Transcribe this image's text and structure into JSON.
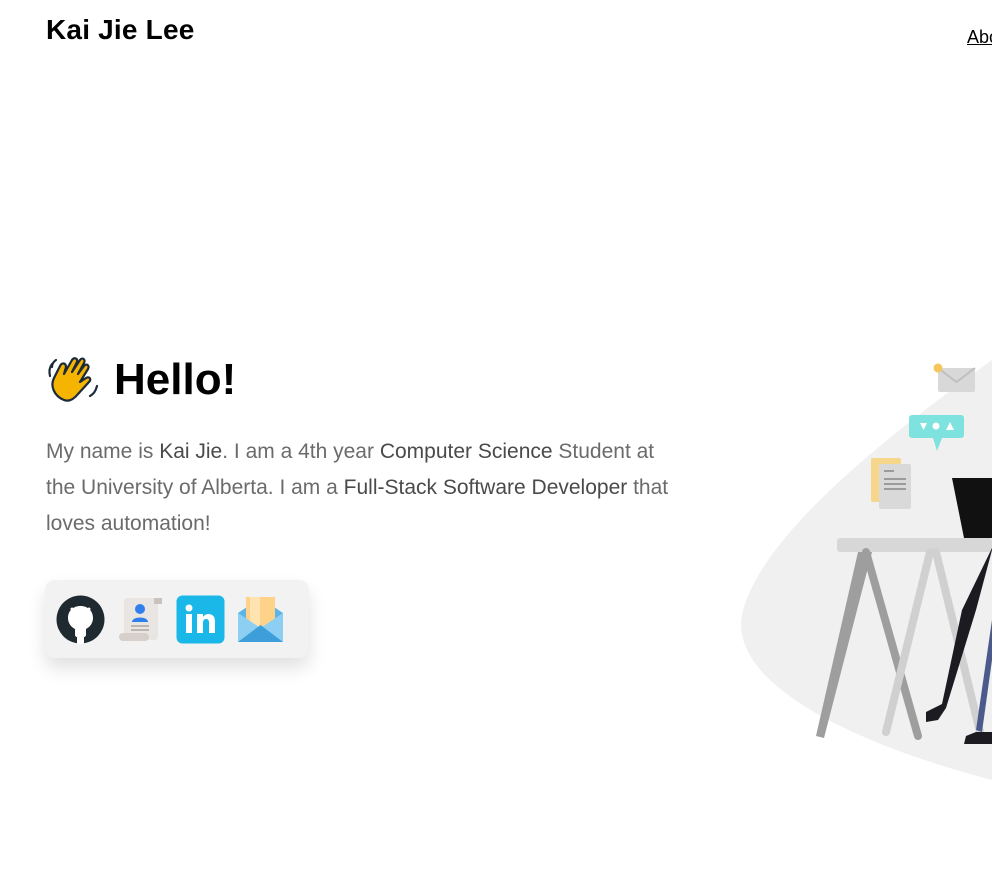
{
  "header": {
    "site_name": "Kai Jie Lee",
    "nav_link_label": "Abo"
  },
  "hero": {
    "title": "Hello!",
    "wave_icon": "waving-hand-icon",
    "intro_parts": {
      "p1": "My name is ",
      "name": "Kai Jie",
      "p2": ". I am a 4th year ",
      "field": "Computer Science",
      "p3": " Student at the University of Alberta. I am a ",
      "role": "Full-Stack Software Developer",
      "p4": " that loves automation!"
    }
  },
  "social": {
    "links": [
      {
        "name": "github",
        "icon": "github-icon"
      },
      {
        "name": "resume",
        "icon": "resume-icon"
      },
      {
        "name": "linkedin",
        "icon": "linkedin-icon",
        "label": "in"
      },
      {
        "name": "email",
        "icon": "email-icon"
      }
    ]
  },
  "colors": {
    "text_primary": "#000000",
    "text_body": "#6b6b6b",
    "card_bg": "#f2f2f3",
    "linkedin": "#1ab8e8"
  }
}
